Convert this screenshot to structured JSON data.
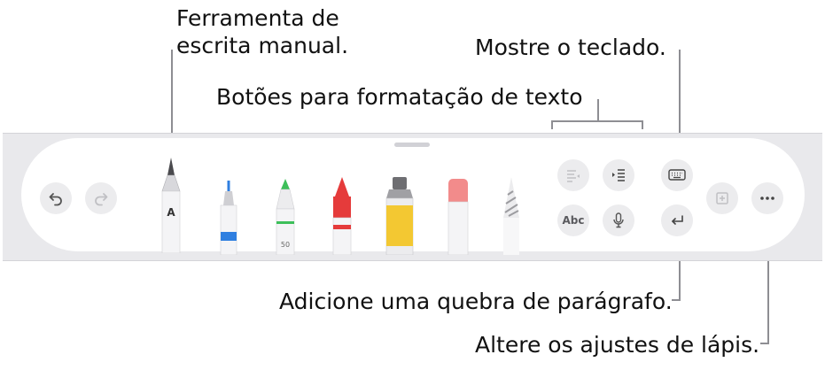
{
  "callouts": {
    "handwriting_tool": {
      "line1": "Ferramenta de",
      "line2": "escrita manual."
    },
    "keyboard": "Mostre o teclado.",
    "formatting": "Botões para formatação de texto",
    "paragraph": "Adicione uma quebra de parágrafo.",
    "pencil_settings": "Altere os ajustes de lápis."
  },
  "toolbar": {
    "buttons": [
      "undo-icon",
      "redo-icon",
      "align-left-icon",
      "indent-icon",
      "abc-button",
      "microphone-icon",
      "keyboard-icon",
      "return-icon",
      "add-space-icon",
      "more-icon"
    ],
    "abc_label": "Abc",
    "pen_label": "A",
    "marker_label": "50",
    "tools": [
      "handwriting-pen",
      "fineliner",
      "marker",
      "crayon",
      "paint-tube",
      "eraser",
      "pencil"
    ]
  },
  "colors": {
    "blue": "#2f7fe0",
    "green": "#3dbf5a",
    "red": "#e53b3b",
    "yellow": "#f3c832",
    "eraser": "#f28b8b",
    "callout_line": "#8e8e93"
  }
}
